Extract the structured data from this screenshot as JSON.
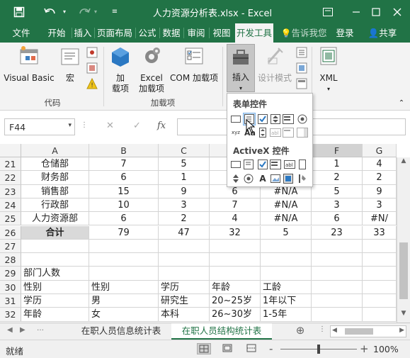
{
  "titlebar": {
    "title": "人力资源分析表.xlsx - Excel",
    "save_icon": "save-icon",
    "undo_icon": "undo-icon",
    "redo_icon": "redo-icon"
  },
  "tabs": [
    "文件",
    "开始",
    "插入",
    "页面布局",
    "公式",
    "数据",
    "审阅",
    "视图",
    "开发工具"
  ],
  "tell_me": "告诉我您",
  "login": "登录",
  "share": "共享",
  "ribbon": {
    "visual_basic": "Visual Basic",
    "macro": "宏",
    "code_group": "代码",
    "addin": "加",
    "addin2": "载项",
    "excel_addin": "Excel",
    "excel_addin2": "加载项",
    "com_addin": "COM 加载项",
    "addin_group": "加载项",
    "insert": "插入",
    "design_mode": "设计模式",
    "xml": "XML"
  },
  "dropdown": {
    "form_controls": "表单控件",
    "activex_controls": "ActiveX 控件"
  },
  "formula": {
    "namebox": "F44",
    "cancel": "✕",
    "enter": "✓",
    "fx": "fx"
  },
  "columns": [
    "A",
    "B",
    "C",
    "D",
    "E",
    "F",
    "G"
  ],
  "rows": [
    {
      "num": "21",
      "cells": [
        "仓储部",
        "7",
        "5",
        "",
        "",
        "1",
        "4"
      ]
    },
    {
      "num": "22",
      "cells": [
        "财务部",
        "6",
        "1",
        "",
        "",
        "2",
        "2"
      ]
    },
    {
      "num": "23",
      "cells": [
        "销售部",
        "15",
        "9",
        "6",
        "#N/A",
        "5",
        "9"
      ]
    },
    {
      "num": "24",
      "cells": [
        "行政部",
        "10",
        "3",
        "7",
        "#N/A",
        "3",
        "3"
      ]
    },
    {
      "num": "25",
      "cells": [
        "人力资源部",
        "6",
        "2",
        "4",
        "#N/A",
        "6",
        "#N/"
      ]
    },
    {
      "num": "26",
      "cells": [
        "合计",
        "79",
        "47",
        "32",
        "5",
        "23",
        "33"
      ]
    },
    {
      "num": "27",
      "cells": [
        "",
        "",
        "",
        "",
        "",
        "",
        ""
      ]
    },
    {
      "num": "28",
      "cells": [
        "",
        "",
        "",
        "",
        "",
        "",
        ""
      ]
    },
    {
      "num": "29",
      "cells": [
        "部门人数",
        "",
        "",
        "",
        "",
        "",
        ""
      ]
    },
    {
      "num": "30",
      "cells": [
        "性别",
        "性别",
        "学历",
        "年龄",
        "工龄",
        "",
        ""
      ]
    },
    {
      "num": "31",
      "cells": [
        "学历",
        "男",
        "研究生",
        "20~25岁",
        "1年以下",
        "",
        ""
      ]
    },
    {
      "num": "32",
      "cells": [
        "年龄",
        "女",
        "本科",
        "26~30岁",
        "1-5年",
        "",
        ""
      ]
    }
  ],
  "sheets": [
    "在职人员信息统计表",
    "在职人员结构统计表"
  ],
  "status": {
    "ready": "就绪",
    "zoom": "100%",
    "minus": "-",
    "plus": "+"
  }
}
